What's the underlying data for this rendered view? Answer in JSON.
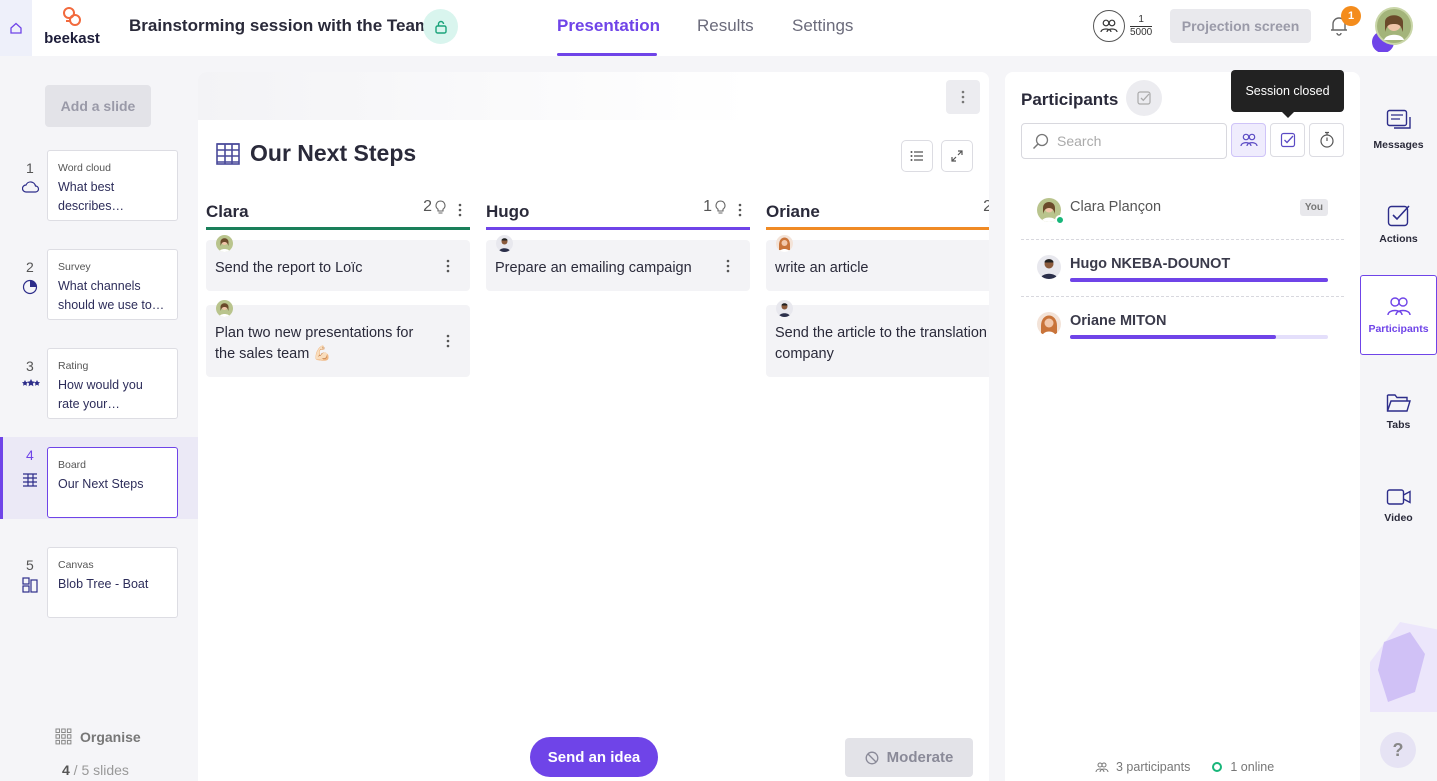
{
  "app": {
    "logo_text": "beekast",
    "session_title": "Brainstorming session with the Team"
  },
  "nav": {
    "tabs": [
      {
        "label": "Presentation"
      },
      {
        "label": "Results"
      },
      {
        "label": "Settings"
      }
    ],
    "active": "Presentation"
  },
  "header": {
    "participants_current": "1",
    "participants_max": "5000",
    "projection_label": "Projection screen",
    "notification_count": "1"
  },
  "slides": {
    "add_label": "Add a slide",
    "items": [
      {
        "num": "1",
        "type": "Word cloud",
        "title": "What best describes Beekas…"
      },
      {
        "num": "2",
        "type": "Survey",
        "title": "What channels should we use to…"
      },
      {
        "num": "3",
        "type": "Rating",
        "title": "How would you rate your Beekast…"
      },
      {
        "num": "4",
        "type": "Board",
        "title": "Our Next Steps"
      },
      {
        "num": "5",
        "type": "Canvas",
        "title": "Blob Tree - Boat"
      }
    ],
    "active_index": 4,
    "organise_label": "Organise",
    "current": "4",
    "total_text": " / 5 slides"
  },
  "board": {
    "title": "Our Next Steps",
    "columns": [
      {
        "name": "Clara",
        "count": "2",
        "color": "#1a7f5a",
        "ideas": [
          {
            "text": "Send the report to Loïc",
            "author": "clara"
          },
          {
            "text": "Plan two new presentations for the sales team 💪🏻",
            "author": "clara"
          }
        ]
      },
      {
        "name": "Hugo",
        "count": "1",
        "color": "#6f44e8",
        "ideas": [
          {
            "text": "Prepare an emailing campaign",
            "author": "hugo"
          }
        ]
      },
      {
        "name": "Oriane",
        "count": "2",
        "color": "#f08a24",
        "ideas": [
          {
            "text": "write an article",
            "author": "oriane"
          },
          {
            "text": "Send the article to the translation company",
            "author": "hugo"
          }
        ]
      }
    ],
    "send_label": "Send an idea",
    "moderate_label": "Moderate"
  },
  "participants": {
    "title": "Participants",
    "tooltip": "Session closed",
    "search_placeholder": "Search",
    "list": [
      {
        "name": "Clara Plançon",
        "badge": "You",
        "progress": null,
        "avatar": "clara"
      },
      {
        "name": "Hugo NKEBA-DOUNOT",
        "badge": "",
        "progress": 1.0,
        "avatar": "hugo"
      },
      {
        "name": "Oriane MITON",
        "badge": "",
        "progress": 0.8,
        "avatar": "oriane"
      }
    ],
    "count_text": "3 participants",
    "online_text": "1 online"
  },
  "rail": {
    "items": [
      {
        "label": "Messages"
      },
      {
        "label": "Actions"
      },
      {
        "label": "Participants"
      },
      {
        "label": "Tabs"
      },
      {
        "label": "Video"
      }
    ],
    "help": "?"
  },
  "colors": {
    "accent": "#6f44e8",
    "online": "#18b67a",
    "notification": "#f48c1c"
  }
}
